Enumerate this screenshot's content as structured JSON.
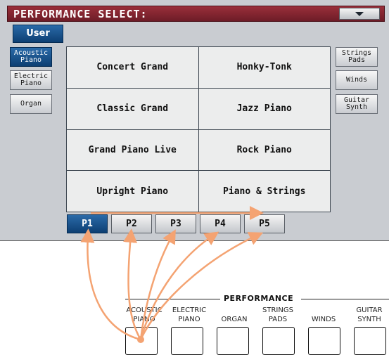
{
  "header": {
    "title": "PERFORMANCE SELECT:",
    "menu_icon": "dropdown-triangle-icon"
  },
  "tabs": {
    "user": "User"
  },
  "left_buttons": [
    {
      "label": "Acoustic\nPiano",
      "selected": true
    },
    {
      "label": "Electric\nPiano",
      "selected": false
    },
    {
      "label": "Organ",
      "selected": false
    }
  ],
  "right_buttons": [
    {
      "label": "Strings\nPads"
    },
    {
      "label": "Winds"
    },
    {
      "label": "Guitar\nSynth"
    }
  ],
  "performances": [
    "Concert Grand",
    "Honky-Tonk",
    "Classic Grand",
    "Jazz Piano",
    "Grand Piano Live",
    "Rock Piano",
    "Upright Piano",
    "Piano & Strings"
  ],
  "pages": [
    {
      "label": "P1",
      "selected": true
    },
    {
      "label": "P2",
      "selected": false
    },
    {
      "label": "P3",
      "selected": false
    },
    {
      "label": "P4",
      "selected": false
    },
    {
      "label": "P5",
      "selected": false
    }
  ],
  "panel": {
    "title": "PERFORMANCE",
    "labels": [
      "ACOUSTIC\nPIANO",
      "ELECTRIC\nPIANO",
      "ORGAN",
      "STRINGS\nPADS",
      "WINDS",
      "GUITAR\nSYNTH"
    ]
  },
  "colors": {
    "title_bar": "#7d2230",
    "selected": "#0d4a85",
    "arrow": "#f4a372"
  }
}
